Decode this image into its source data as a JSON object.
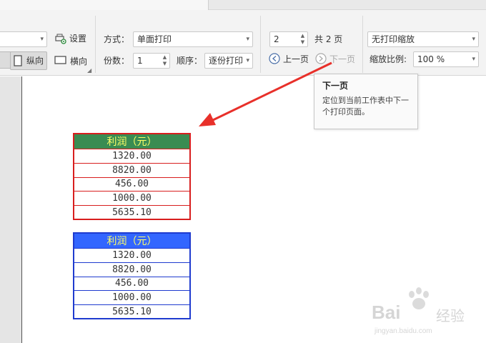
{
  "ribbon": {
    "settings_label": "设置",
    "portrait_label": "纵向",
    "landscape_label": "横向",
    "mode_label": "方式：",
    "mode_value": "单面打印",
    "copies_label": "份数：",
    "copies_value": "1",
    "order_label": "顺序：",
    "order_value": "逐份打印",
    "page_value": "2",
    "total_pages": "共 2 页",
    "prev_label": "上一页",
    "next_label": "下一页",
    "scaling_value": "无打印缩放",
    "zoom_label": "缩放比例:",
    "zoom_value": "100 %"
  },
  "tooltip": {
    "title": "下一页",
    "description": "定位到当前工作表中下一个打印页面。"
  },
  "tables": [
    {
      "header": "利润（元）",
      "rows": [
        "1320.00",
        "8820.00",
        "456.00",
        "1000.00",
        "5635.10"
      ],
      "header_color": "#3a8c52",
      "border_color": "#d81e1e"
    },
    {
      "header": "利润（元）",
      "rows": [
        "1320.00",
        "8820.00",
        "456.00",
        "1000.00",
        "5635.10"
      ],
      "header_color": "#3366ff",
      "border_color": "#1f3bcf"
    }
  ],
  "watermark": {
    "brand": "Bai",
    "brand_suffix": "经验",
    "url": "jingyan.baidu.com"
  },
  "annotation_color": "#e8302a"
}
